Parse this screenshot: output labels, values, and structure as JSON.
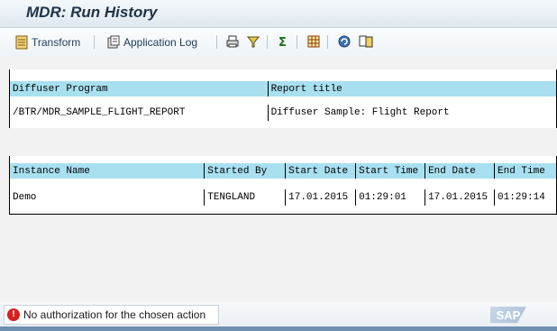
{
  "window": {
    "title": "MDR: Run History"
  },
  "toolbar": {
    "transform_label": "Transform",
    "application_log_label": "Application Log"
  },
  "program_table": {
    "headers": [
      "Diffuser Program",
      "Report title"
    ],
    "rows": [
      [
        "/BTR/MDR_SAMPLE_FLIGHT_REPORT",
        "Diffuser Sample: Flight Report"
      ]
    ]
  },
  "instance_table": {
    "headers": [
      "Instance Name",
      "Started By",
      "Start Date",
      "Start Time",
      "End Date",
      "End Time"
    ],
    "rows": [
      [
        "Demo",
        "TENGLAND",
        "17.01.2015",
        "01:29:01",
        "17.01.2015",
        "01:29:14"
      ]
    ]
  },
  "status": {
    "message": "No authorization for the chosen action",
    "type": "error",
    "logo": "SAP"
  },
  "colors": {
    "header_cell": "#a8e0f0",
    "title_text": "#1f3246",
    "error": "#d82020"
  }
}
